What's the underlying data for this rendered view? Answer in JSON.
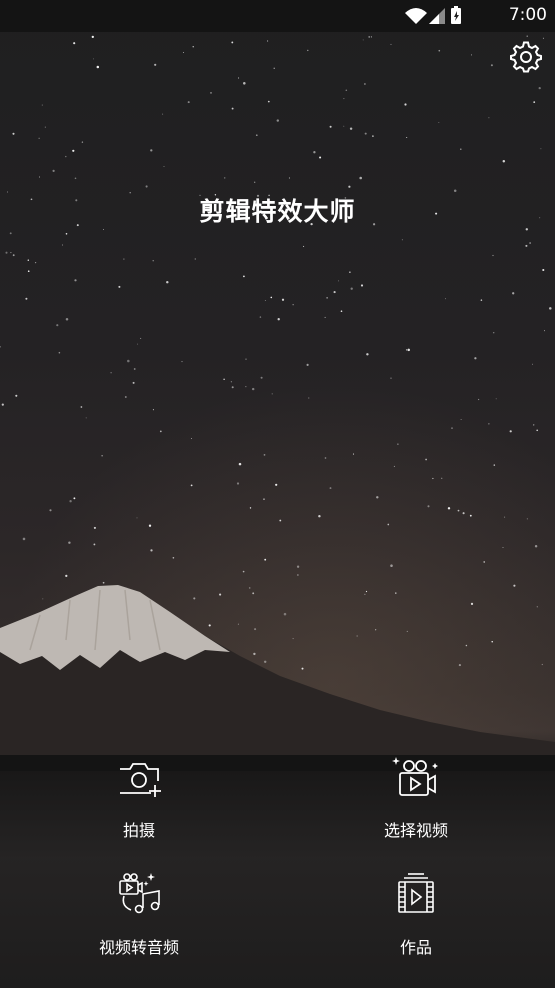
{
  "status_bar": {
    "time": "7:00"
  },
  "settings": {
    "icon": "gear-icon"
  },
  "app_title": "剪辑特效大师",
  "actions": [
    {
      "label": "拍摄",
      "icon": "camera-add-icon"
    },
    {
      "label": "选择视频",
      "icon": "video-camera-icon"
    },
    {
      "label": "视频转音频",
      "icon": "video-to-audio-icon"
    },
    {
      "label": "作品",
      "icon": "film-library-icon"
    }
  ],
  "colors": {
    "text": "#ffffff",
    "background": "#1c1b1c"
  }
}
